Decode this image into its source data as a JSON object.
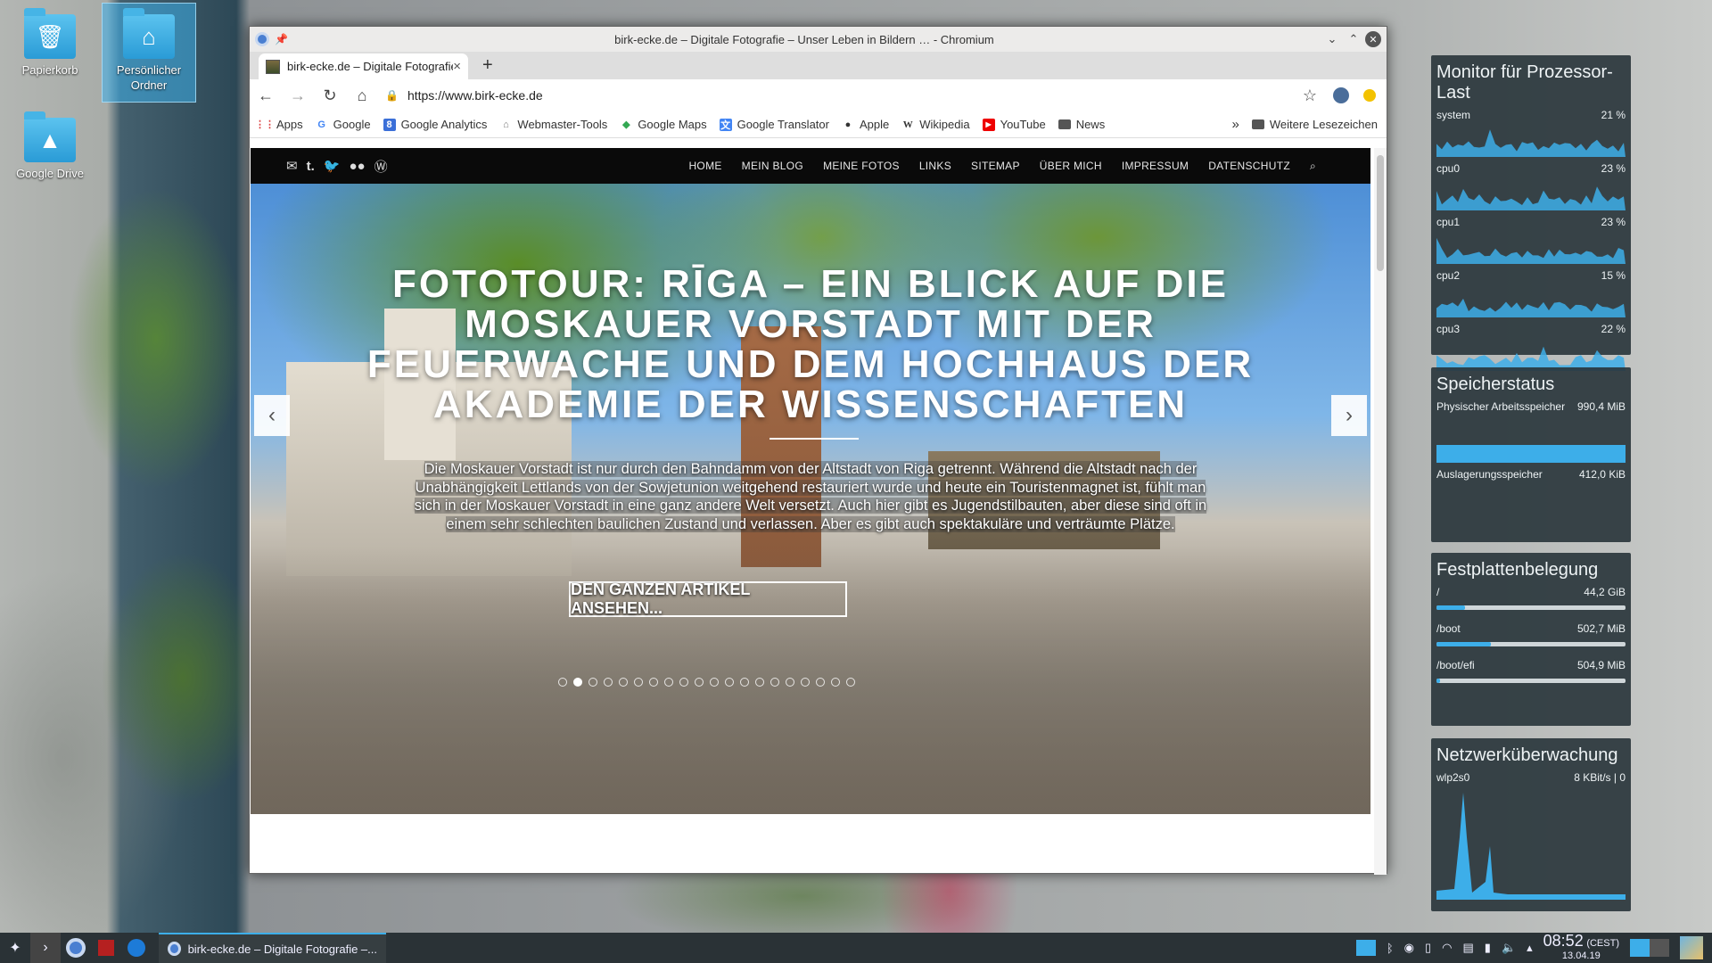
{
  "desktop": {
    "icons": [
      {
        "label": "Papierkorb",
        "glyph": "🗑"
      },
      {
        "label": "Persönlicher Ordner",
        "glyph": "⌂"
      },
      {
        "label": "Google Drive",
        "glyph": "▲"
      }
    ]
  },
  "window": {
    "title": "birk-ecke.de – Digitale Fotografie – Unser Leben in Bildern … - Chromium"
  },
  "tab": {
    "label": "birk-ecke.de – Digitale Fotografie",
    "close": "×",
    "new": "+"
  },
  "omnibox": {
    "url": "https://www.birk-ecke.de"
  },
  "bookmarks": {
    "items": [
      {
        "label": "Apps",
        "icon": "apps-icon",
        "color": "#d44"
      },
      {
        "label": "Google",
        "icon": "google-icon",
        "color": "#4285f4"
      },
      {
        "label": "Google Analytics",
        "icon": "analytics-icon",
        "color": "#3b6fd8"
      },
      {
        "label": "Webmaster-Tools",
        "icon": "webmaster-icon",
        "color": "#888"
      },
      {
        "label": "Google Maps",
        "icon": "maps-icon",
        "color": "#34a853"
      },
      {
        "label": "Google Translator",
        "icon": "translate-icon",
        "color": "#4285f4"
      },
      {
        "label": "Apple",
        "icon": "apple-icon",
        "color": "#333"
      },
      {
        "label": "Wikipedia",
        "icon": "wikipedia-icon",
        "color": "#000"
      },
      {
        "label": "YouTube",
        "icon": "youtube-icon",
        "color": "#e00"
      },
      {
        "label": "News",
        "icon": "folder-icon",
        "color": "#555"
      }
    ],
    "more": "»",
    "other": "Weitere Lesezeichen"
  },
  "site": {
    "menu": [
      "HOME",
      "MEIN BLOG",
      "MEINE FOTOS",
      "LINKS",
      "SITEMAP",
      "ÜBER MICH",
      "IMPRESSUM",
      "DATENSCHUTZ"
    ],
    "hero_title": "FOTOTOUR: RĪGA – EIN BLICK AUF DIE MOSKAUER VORSTADT MIT DER FEUERWACHE UND DEM HOCHHAUS DER AKADEMIE DER WISSENSCHAFTEN",
    "excerpt": "Die Moskauer Vorstadt ist nur durch den Bahndamm von der Altstadt von Riga getrennt. Während die Altstadt nach der Unabhängigkeit Lettlands von der Sowjetunion weitgehend restauriert wurde und heute ein Touristenmagnet ist, fühlt man sich in der Moskauer Vorstadt in eine ganz andere Welt versetzt. Auch hier gibt es Jugendstilbauten, aber diese sind oft in einem sehr schlechten baulichen Zustand und verlassen. Aber es gibt auch spektakuläre und verträumte Plätze.",
    "cta": "DEN GANZEN ARTIKEL ANSEHEN...",
    "slides_total": 20,
    "slide_active": 2
  },
  "widgets": {
    "cpu": {
      "title": "Monitor für Prozessor-Last",
      "rows": [
        {
          "label": "system",
          "value": "21 %"
        },
        {
          "label": "cpu0",
          "value": "23 %"
        },
        {
          "label": "cpu1",
          "value": "23 %"
        },
        {
          "label": "cpu2",
          "value": "15 %"
        },
        {
          "label": "cpu3",
          "value": "22 %"
        }
      ]
    },
    "mem": {
      "title": "Speicherstatus",
      "rows": [
        {
          "label": "Physischer Arbeitsspeicher",
          "value": "990,4 MiB"
        },
        {
          "label": "Auslagerungsspeicher",
          "value": "412,0 KiB"
        }
      ]
    },
    "disk": {
      "title": "Festplattenbelegung",
      "rows": [
        {
          "label": "/",
          "value": "44,2 GiB",
          "fill": 0.15
        },
        {
          "label": "/boot",
          "value": "502,7 MiB",
          "fill": 0.29
        },
        {
          "label": "/boot/efi",
          "value": "504,9 MiB",
          "fill": 0.02
        }
      ]
    },
    "net": {
      "title": "Netzwerküberwachung",
      "iface": "wlp2s0",
      "value": "8 KBit/s | 0"
    }
  },
  "taskbar": {
    "task_label": "birk-ecke.de – Digitale Fotografie –...",
    "time": "08:52",
    "tz": "(CEST)",
    "date": "13.04.19"
  }
}
